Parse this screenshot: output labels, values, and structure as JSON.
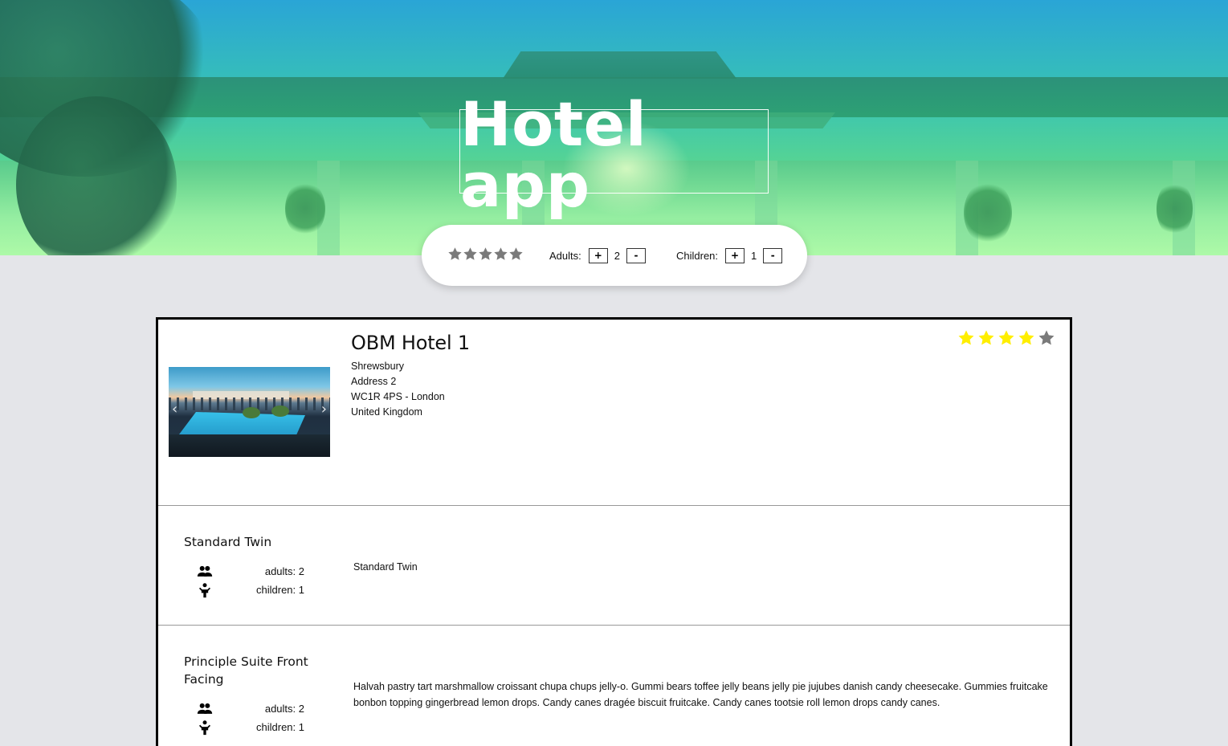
{
  "app": {
    "title": "Hotel app"
  },
  "filters": {
    "star_count": 5,
    "adults": {
      "label": "Adults:",
      "value": "2",
      "plus": "+",
      "minus": "-"
    },
    "children": {
      "label": "Children:",
      "value": "1",
      "plus": "+",
      "minus": "-"
    }
  },
  "hotel": {
    "name": "OBM Hotel 1",
    "address": [
      "Shrewsbury",
      "Address 2",
      "WC1R 4PS - London",
      "United Kingdom"
    ],
    "rating": 4,
    "rating_max": 5,
    "carousel": {
      "prev": "‹",
      "next": "›"
    }
  },
  "rooms": [
    {
      "name": "Standard Twin",
      "adults_text": "adults: 2",
      "children_text": "children: 1",
      "description": "Standard Twin"
    },
    {
      "name": "Principle Suite Front Facing",
      "adults_text": "adults: 2",
      "children_text": "children: 1",
      "description": "Halvah pastry tart marshmallow croissant chupa chups jelly-o. Gummi bears toffee jelly beans jelly pie jujubes danish candy cheesecake. Gummies fruitcake bonbon topping gingerbread lemon drops. Candy canes dragée biscuit fruitcake. Candy canes tootsie roll lemon drops candy canes."
    }
  ],
  "colors": {
    "star_filled": "#ffee00",
    "star_empty": "#7a7a7a",
    "filter_star": "#7a7a7a",
    "page_bg": "#e4e5e9"
  }
}
